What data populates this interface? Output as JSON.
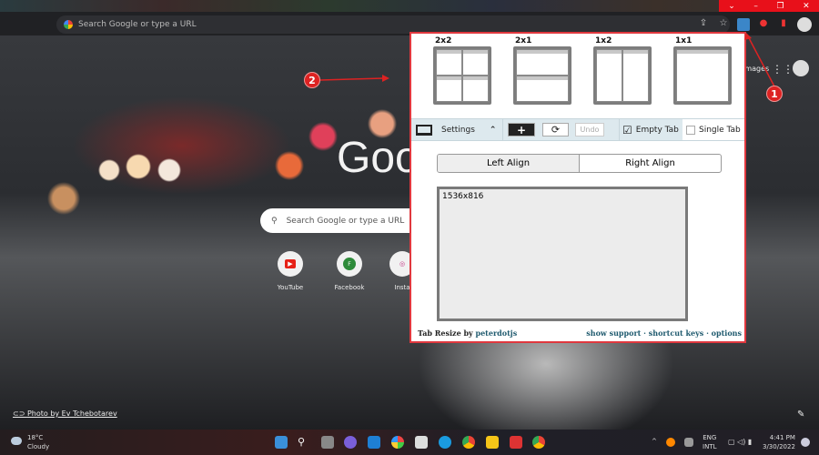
{
  "browser": {
    "omnibox_placeholder": "Search Google or type a URL",
    "window_controls": [
      "⌄",
      "–",
      "❐",
      "✕"
    ]
  },
  "ntp": {
    "logo": "Goog",
    "search_placeholder": "Search Google or type a URL",
    "images_link": "Images",
    "shortcuts": [
      {
        "label": "YouTube",
        "color": "#e62117",
        "letter": "▶"
      },
      {
        "label": "Facebook",
        "color": "#2e8b3a",
        "letter": "F"
      },
      {
        "label": "Insta",
        "color": "#c13584",
        "letter": "◎"
      }
    ],
    "photo_credit": "Photo by Ev Tchebotarev"
  },
  "popup": {
    "layouts": [
      {
        "label": "2x2",
        "cells": 4,
        "cols": 2
      },
      {
        "label": "2x1",
        "cells": 2,
        "cols": 1
      },
      {
        "label": "1x2",
        "cells": 2,
        "cols": 2
      },
      {
        "label": "1x1",
        "cells": 1,
        "cols": 1
      }
    ],
    "settings_label": "Settings",
    "add_label": "+",
    "refresh_label": "⟳",
    "undo_label": "Undo",
    "empty_tab_label": "Empty Tab",
    "empty_tab_checked": true,
    "single_tab_label": "Single Tab",
    "single_tab_checked": false,
    "left_align": "Left Align",
    "right_align": "Right Align",
    "resolution": "1536x816",
    "footer": {
      "prefix": "Tab Resize by",
      "author": "peterdotjs",
      "show_support": "show support",
      "shortcut_keys": "shortcut keys",
      "options": "options",
      "sep": "·"
    }
  },
  "annotations": {
    "one": "1",
    "two": "2"
  },
  "taskbar": {
    "temp": "18°C",
    "weather": "Cloudy",
    "lang": "ENG",
    "layout": "INTL",
    "time": "4:41 PM",
    "date": "3/30/2022"
  }
}
